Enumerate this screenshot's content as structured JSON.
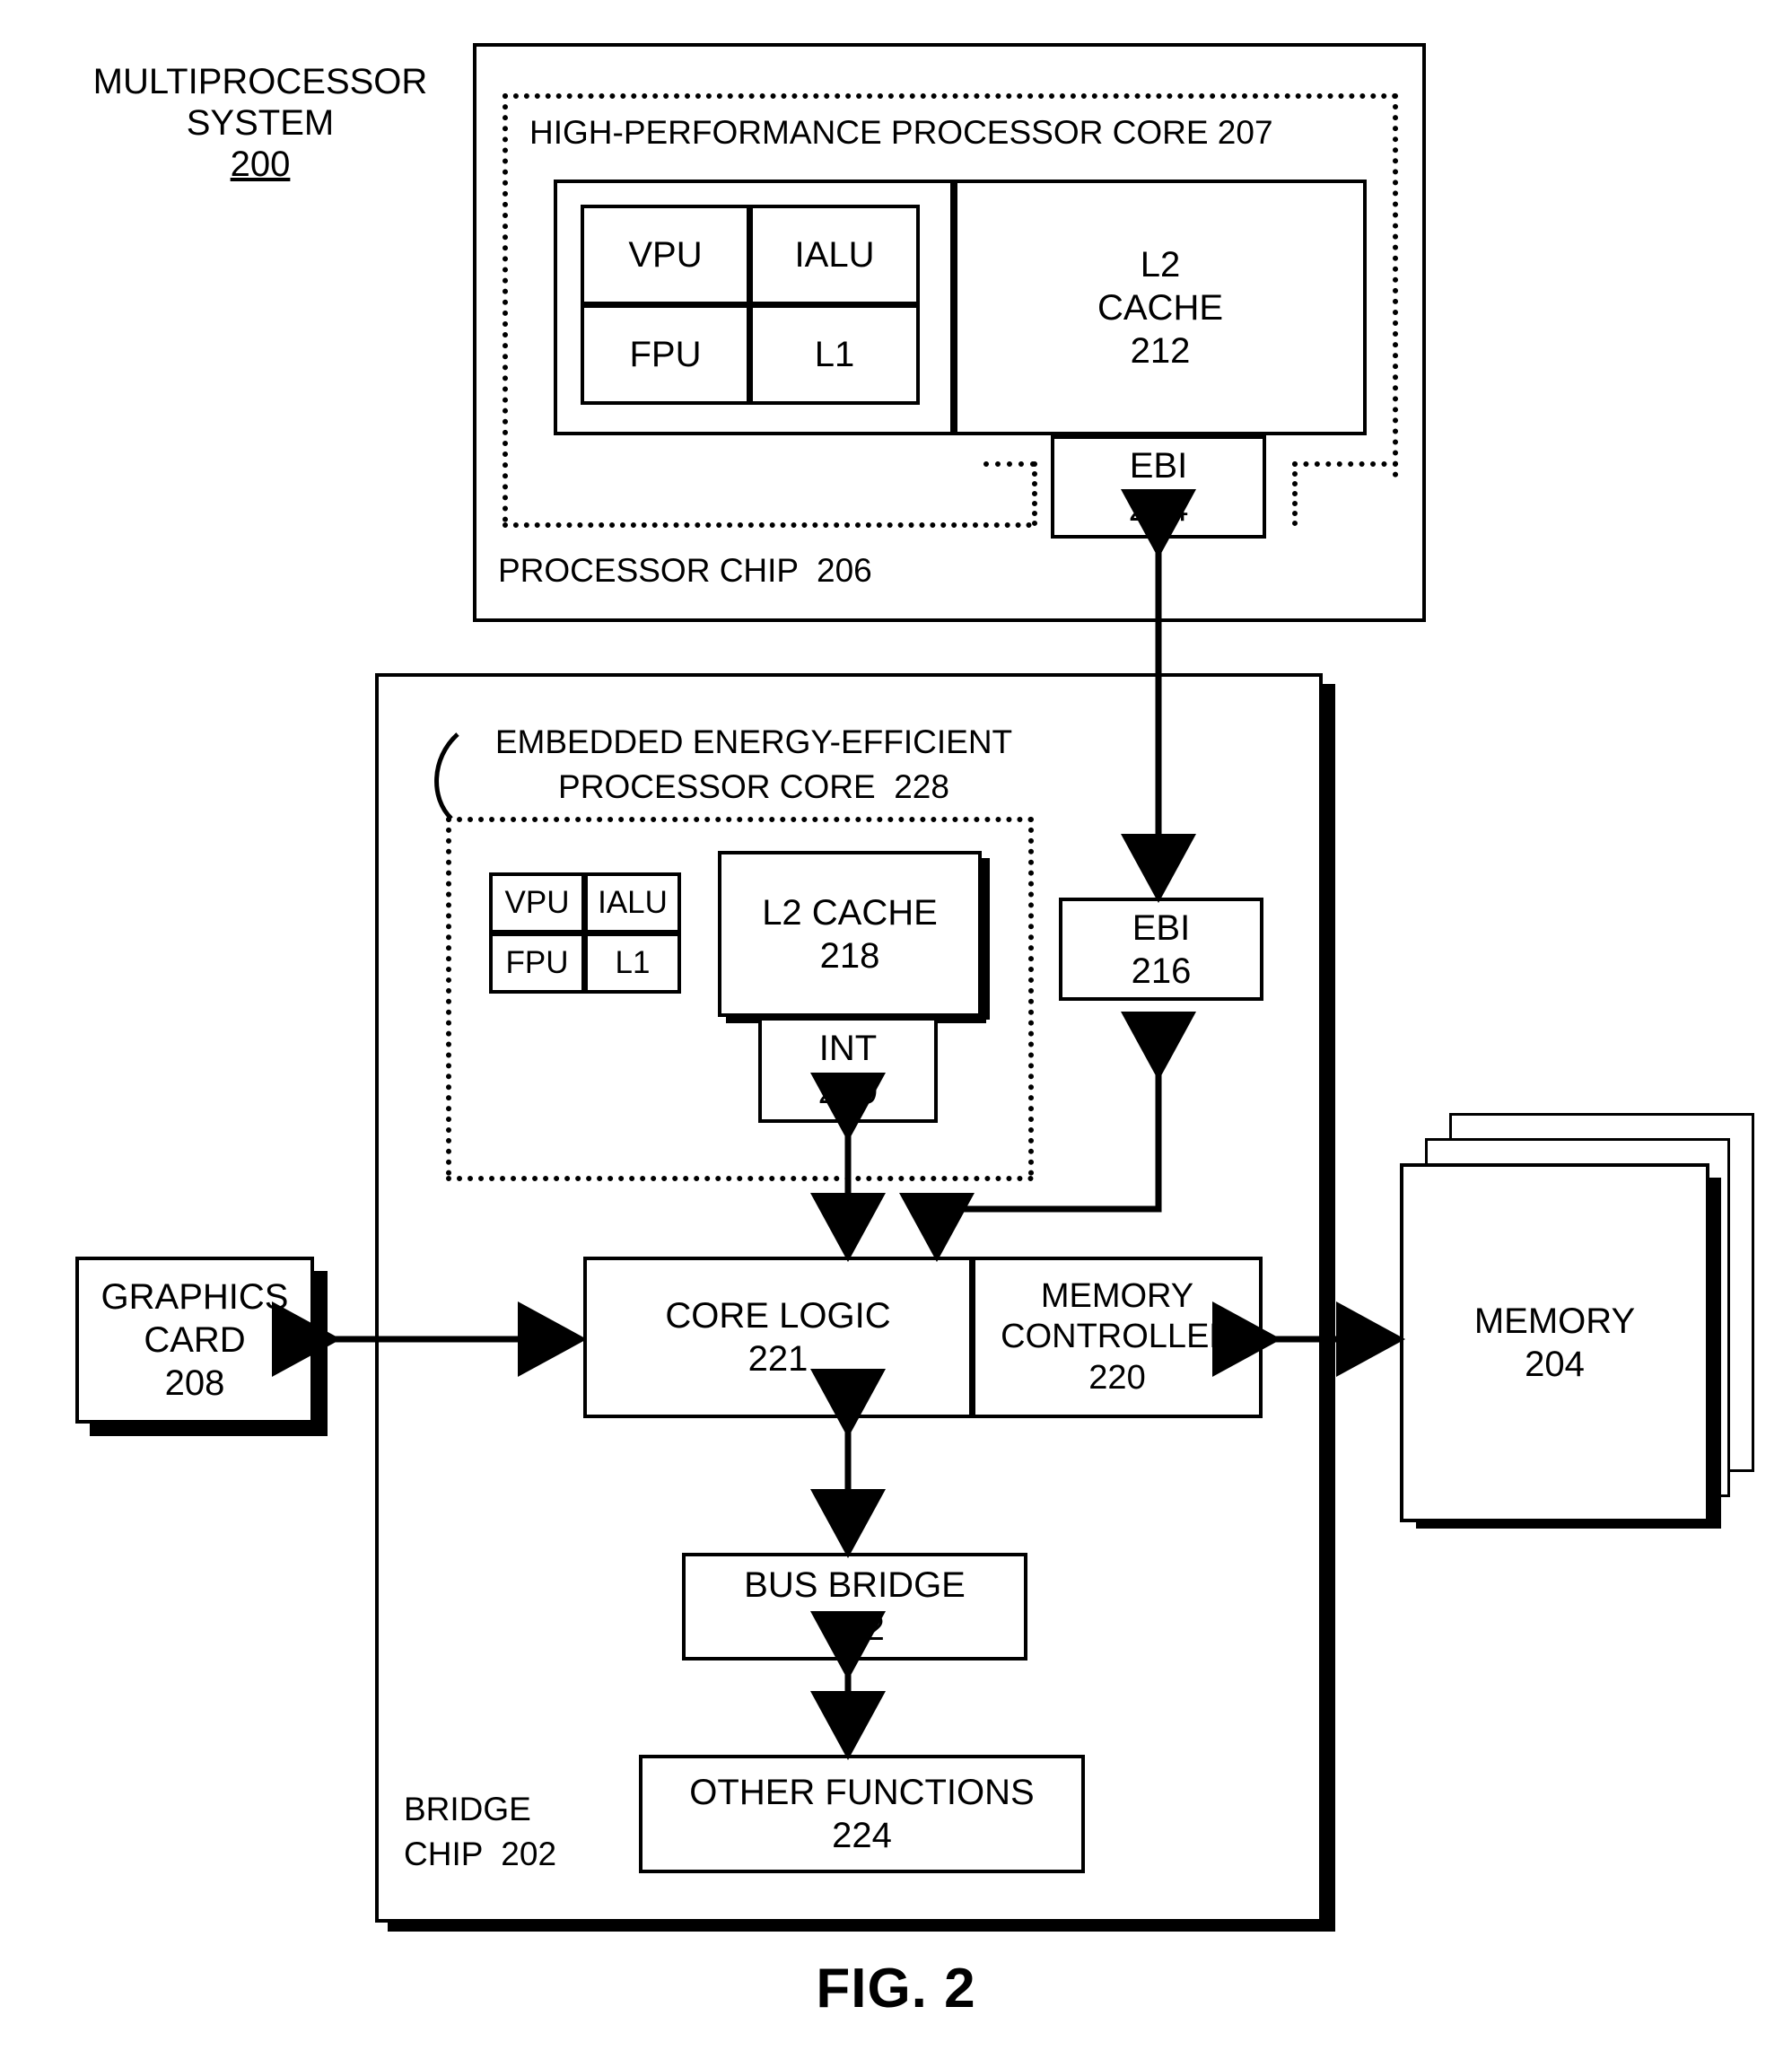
{
  "figure": {
    "caption": "FIG. 2",
    "system_title_line1": "MULTIPROCESSOR",
    "system_title_line2": "SYSTEM",
    "system_ref": "200"
  },
  "processor_chip": {
    "label": "PROCESSOR CHIP  206",
    "core_label": "HIGH-PERFORMANCE PROCESSOR CORE 207",
    "units": {
      "vpu": "VPU",
      "ialu": "IALU",
      "fpu": "FPU",
      "l1": "L1"
    },
    "l2_cache": {
      "line1": "L2",
      "line2": "CACHE",
      "line3": "212"
    },
    "ebi": {
      "line1": "EBI",
      "line2": "214"
    }
  },
  "bridge_chip": {
    "label_line1": "BRIDGE",
    "label_line2": "CHIP  202",
    "core_label_line1": "EMBEDDED ENERGY-EFFICIENT",
    "core_label_line2": "PROCESSOR CORE  228",
    "units": {
      "vpu": "VPU",
      "ialu": "IALU",
      "fpu": "FPU",
      "l1": "L1"
    },
    "l2_cache": {
      "line1": "L2 CACHE",
      "line2": "218"
    },
    "int": {
      "line1": "INT",
      "line2": "219"
    },
    "ebi": {
      "line1": "EBI",
      "line2": "216"
    },
    "core_logic": {
      "line1": "CORE LOGIC",
      "line2": "221"
    },
    "memory_controller": {
      "line1": "MEMORY",
      "line2": "CONTROLLER",
      "line3": "220"
    },
    "bus_bridge": {
      "line1": "BUS BRIDGE",
      "line2": "222"
    },
    "other_functions": {
      "line1": "OTHER FUNCTIONS",
      "line2": "224"
    }
  },
  "peripherals": {
    "graphics_card": {
      "line1": "GRAPHICS",
      "line2": "CARD",
      "line3": "208"
    },
    "memory": {
      "line1": "MEMORY",
      "line2": "204"
    }
  },
  "colors": {
    "ink": "#000000",
    "paper": "#ffffff"
  }
}
